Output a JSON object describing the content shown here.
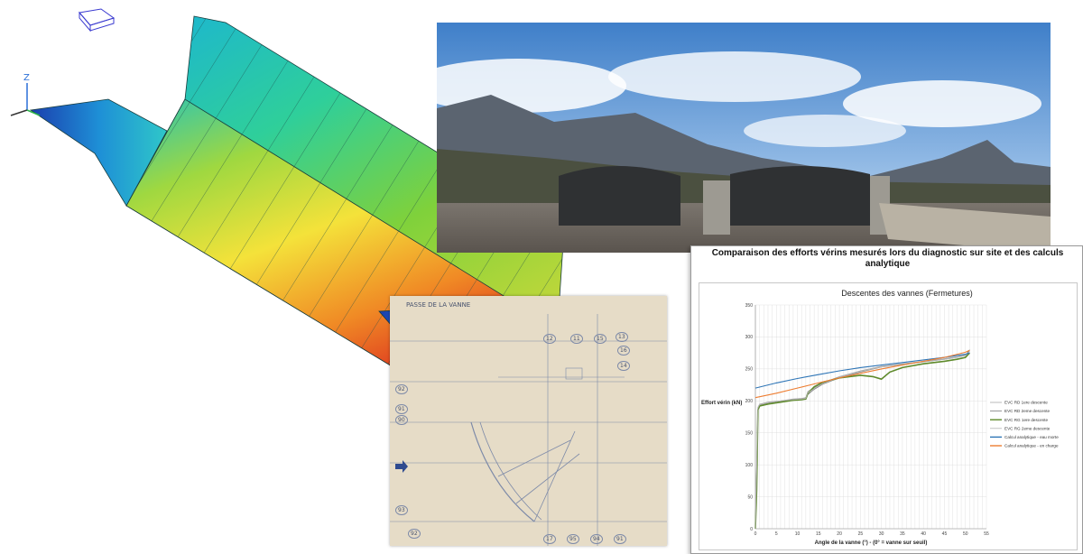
{
  "header": "Comparaison des efforts vérins mesurés lors du diagnostic sur site et des calculs analytique",
  "drawing": {
    "title": "PASSE DE LA VANNE",
    "numbers": [
      "12",
      "11",
      "15",
      "13",
      "16",
      "14",
      "92",
      "91",
      "90",
      "93",
      "92",
      "17",
      "95",
      "94",
      "91"
    ]
  },
  "icons": {
    "triad": "axis-triad-icon",
    "view_cube": "view-cube-icon",
    "arrow": "arrow-right-icon",
    "marker": "star-marker-icon"
  },
  "colors": {
    "background": "#ffffff",
    "grid": "#d9d9d9"
  },
  "chart_data": {
    "type": "line",
    "title": "Descentes des vannes (Fermetures)",
    "xlabel": "Angle de la vanne (°)  -  (0° = vanne sur seuil)",
    "ylabel": "Effort vérin (kN)",
    "xlim": [
      0,
      55
    ],
    "ylim": [
      0,
      350
    ],
    "x_ticks": [
      0,
      1,
      2,
      3,
      4,
      5,
      6,
      7,
      8,
      9,
      10,
      11,
      12,
      13,
      14,
      15,
      16,
      17,
      18,
      19,
      20,
      21,
      22,
      23,
      24,
      25,
      26,
      27,
      28,
      29,
      30,
      31,
      32,
      33,
      34,
      35,
      36,
      37,
      38,
      39,
      40,
      41,
      42,
      43,
      44,
      45,
      46,
      47,
      48,
      49,
      50,
      51,
      52,
      53,
      54,
      55
    ],
    "x_tick_labels": [
      "0",
      "5",
      "10",
      "15",
      "20",
      "25",
      "30",
      "35",
      "40",
      "45",
      "50",
      "55"
    ],
    "y_ticks": [
      0,
      50,
      100,
      150,
      200,
      250,
      300,
      350
    ],
    "grid": true,
    "legend_position": "right",
    "series": [
      {
        "name": "EVC RD 1ere descente",
        "color": "#a6a6a6",
        "x": [
          0,
          0.3,
          0.6,
          1,
          3,
          6,
          9,
          11,
          12,
          12.5,
          14,
          16,
          20,
          25,
          30,
          35,
          40,
          45,
          48,
          50,
          51
        ],
        "y": [
          0,
          100,
          190,
          195,
          198,
          200,
          203,
          204,
          205,
          215,
          220,
          228,
          238,
          247,
          254,
          258,
          262,
          266,
          269,
          272,
          278
        ]
      },
      {
        "name": "EVC RD 2eme descente",
        "color": "#7f7f7f",
        "x": [
          0,
          0.3,
          0.6,
          1,
          3,
          6,
          9,
          11,
          12,
          12.5,
          14,
          16,
          20,
          25,
          30,
          35,
          40,
          45,
          48,
          50,
          51
        ],
        "y": [
          0,
          80,
          188,
          193,
          196,
          199,
          202,
          203,
          204,
          210,
          218,
          226,
          236,
          245,
          253,
          257,
          261,
          265,
          268,
          271,
          280
        ]
      },
      {
        "name": "EVC RG 1ere descente",
        "color": "#5e8a2b",
        "x": [
          0,
          0.3,
          0.6,
          1,
          3,
          6,
          9,
          11,
          12,
          12.5,
          14,
          16,
          20,
          25,
          28,
          30,
          32,
          35,
          40,
          45,
          48,
          50,
          51
        ],
        "y": [
          0,
          60,
          186,
          192,
          195,
          198,
          201,
          202,
          203,
          212,
          222,
          229,
          236,
          240,
          238,
          234,
          245,
          252,
          258,
          262,
          265,
          268,
          275
        ]
      },
      {
        "name": "EVC RG 2eme descente",
        "color": "#b3b3b3",
        "x": [
          0,
          0.3,
          0.6,
          1,
          3,
          6,
          9,
          11,
          12,
          12.5,
          14,
          16,
          20,
          25,
          30,
          35,
          40,
          45,
          48,
          50,
          51
        ],
        "y": [
          0,
          90,
          189,
          194,
          197,
          200,
          202,
          203,
          204,
          213,
          219,
          227,
          237,
          246,
          253,
          257,
          261,
          265,
          268,
          271,
          276
        ]
      },
      {
        "name": "Calcul analytique - eau morte",
        "color": "#2e75b6",
        "x": [
          0,
          5,
          10,
          15,
          20,
          25,
          30,
          35,
          40,
          45,
          50,
          51
        ],
        "y": [
          220,
          228,
          235,
          241,
          247,
          252,
          256,
          260,
          264,
          268,
          273,
          275
        ]
      },
      {
        "name": "Calcul analytique - en charge",
        "color": "#ed7d31",
        "x": [
          0,
          5,
          10,
          15,
          20,
          25,
          30,
          35,
          40,
          45,
          50,
          51
        ],
        "y": [
          205,
          212,
          220,
          228,
          236,
          243,
          250,
          256,
          262,
          268,
          276,
          279
        ]
      }
    ]
  }
}
